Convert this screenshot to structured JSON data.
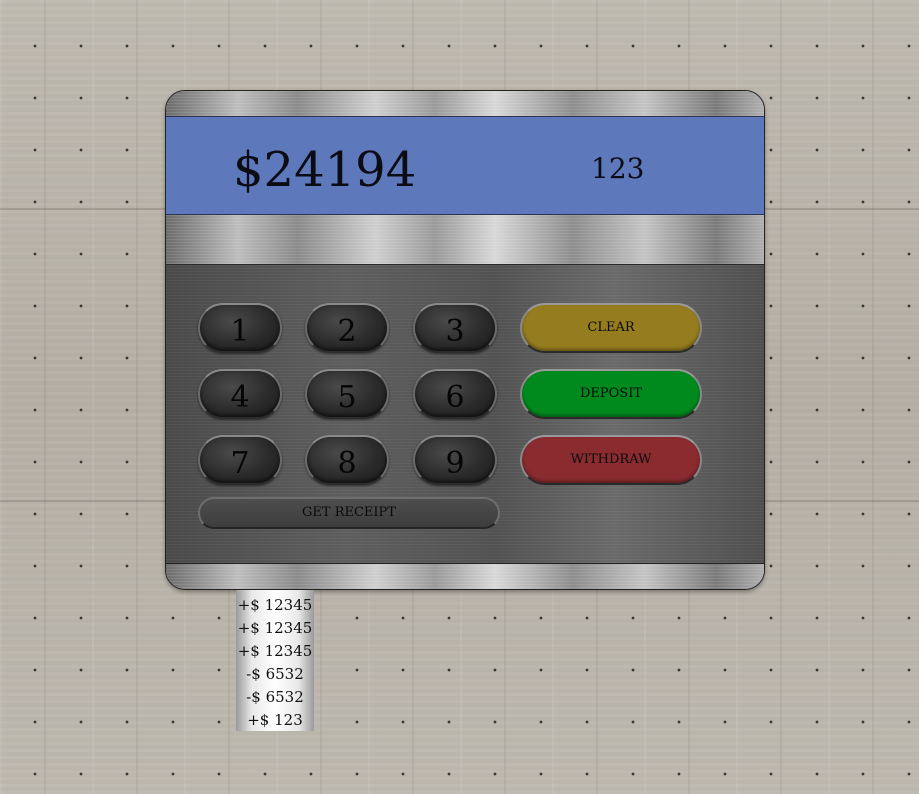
{
  "display": {
    "balance": "$24194",
    "entry": "123"
  },
  "keypad": {
    "keys": [
      "1",
      "2",
      "3",
      "4",
      "5",
      "6",
      "7",
      "8",
      "9"
    ]
  },
  "actions": {
    "clear_label": "CLEAR",
    "deposit_label": "DEPOSIT",
    "withdraw_label": "WITHDRAW",
    "receipt_label": "GET RECEIPT"
  },
  "colors": {
    "screen": "#5d78bb",
    "clear": "#957c1f",
    "deposit": "#008a1e",
    "withdraw": "#8a2b30"
  },
  "receipt": {
    "lines": [
      "+$ 12345",
      "+$ 12345",
      "+$ 12345",
      "-$ 6532",
      "-$ 6532",
      "+$ 123"
    ]
  }
}
